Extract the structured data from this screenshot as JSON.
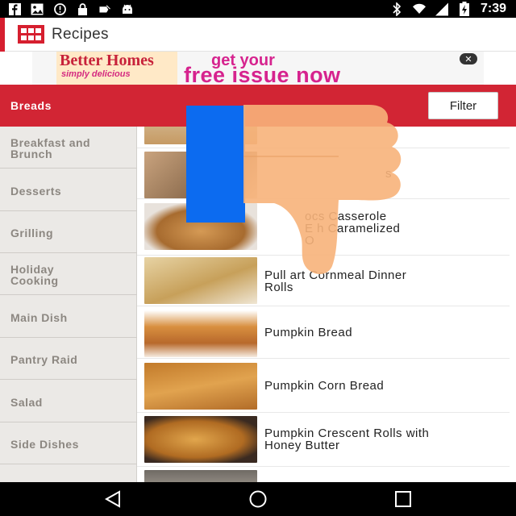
{
  "status_bar": {
    "left_icons": [
      "facebook-icon",
      "image-icon",
      "alert-icon",
      "lock-icon",
      "fast-icon",
      "android-icon"
    ],
    "right_icons": [
      "bluetooth-icon",
      "wifi-icon",
      "signal-icon",
      "battery-icon"
    ],
    "time": "7:39"
  },
  "toolbar": {
    "title": "Recipes",
    "logo_color": "#d61f2f"
  },
  "ad": {
    "magazine_title": "Better Homes",
    "magazine_sub": "simply delicious",
    "line1": "get your",
    "line2": "free issue now",
    "close": "✕"
  },
  "category": {
    "title": "Breads",
    "filter_label": "Filter",
    "accent": "#d22534"
  },
  "sidebar": {
    "items": [
      {
        "label": "Breakfast and\nBrunch"
      },
      {
        "label": "Desserts"
      },
      {
        "label": "Grilling"
      },
      {
        "label": "Holiday\nCooking"
      },
      {
        "label": "Main Dish"
      },
      {
        "label": "Pantry Raid"
      },
      {
        "label": "Salad"
      },
      {
        "label": "Side Dishes"
      }
    ]
  },
  "recipes": [
    {
      "title": ""
    },
    {
      "title": "s"
    },
    {
      "title": "ocs Casserole\nE   h Caramelized\nO"
    },
    {
      "title": "Pull   art Cornmeal Dinner\nRolls"
    },
    {
      "title": "Pumpkin Bread"
    },
    {
      "title": "Pumpkin Corn Bread"
    },
    {
      "title": "Pumpkin Crescent Rolls with\nHoney Butter"
    },
    {
      "title": ""
    }
  ],
  "nav": {
    "icons": [
      "back-icon",
      "home-icon",
      "recents-icon"
    ]
  }
}
